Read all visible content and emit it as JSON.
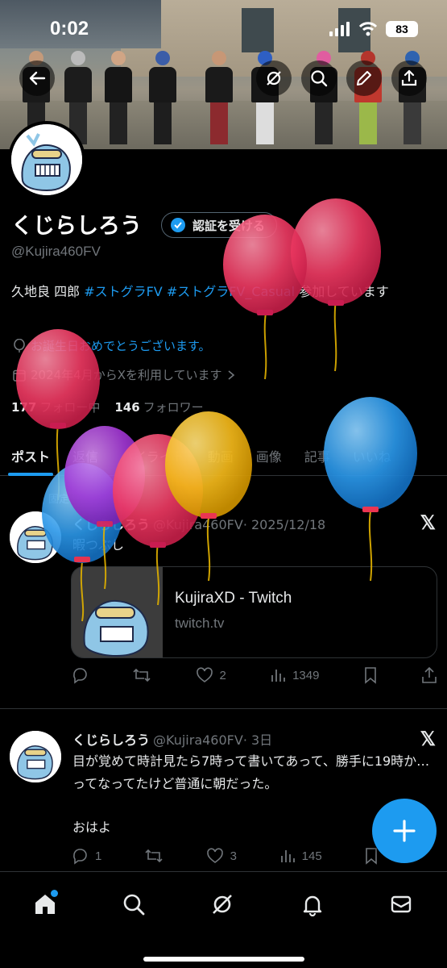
{
  "status_bar": {
    "time": "0:02",
    "battery": "83"
  },
  "profile": {
    "name": "くじらしろう",
    "verify_label": "認証を受ける",
    "handle": "@Kujira460FV",
    "bio_prefix": "久地良 四郎 ",
    "bio_tag1": "#ストグラFV",
    "bio_tag2": "#ストグラFV_Casual",
    "bio_suffix": " 参加しています",
    "birthday": "お誕生日おめでとうございます。",
    "joined": "2024年4月からXを利用しています",
    "following_count": "177",
    "following_label": "フォロー中",
    "followers_count": "146",
    "followers_label": "フォロワー"
  },
  "tabs": [
    {
      "label": "ポスト"
    },
    {
      "label": "返信"
    },
    {
      "label": "ハイライト"
    },
    {
      "label": "動画"
    },
    {
      "label": "画像"
    },
    {
      "label": "記事"
    },
    {
      "label": "いいね"
    }
  ],
  "pinned_label": "固定",
  "tweets": [
    {
      "name": "くじらしろう",
      "handle": "@Kujira460FV",
      "time": "· 2025/12/18",
      "text": "暇つぶし",
      "card": {
        "title": "KujiraXD - Twitch",
        "domain": "twitch.tv"
      },
      "replies": "",
      "retweets": "",
      "likes": "2",
      "views": "1349"
    },
    {
      "name": "くじらしろう",
      "handle": "@Kujira460FV",
      "time": "· 3日",
      "text": "目が覚めて時計見たら7時って書いてあって、勝手に19時か…ってなってたけど普通に朝だった。",
      "text2": "おはよ",
      "replies": "1",
      "retweets": "",
      "likes": "3",
      "views": "145"
    }
  ],
  "colors": {
    "accent": "#1d9bf0",
    "text": "#e7e9ea",
    "muted": "#71767b",
    "border": "#2f3336"
  }
}
